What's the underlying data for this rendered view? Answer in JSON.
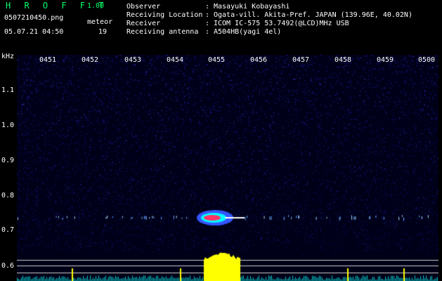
{
  "header": {
    "app_title": "H R O F F T",
    "app_version": "1.00",
    "filename": "0507210450.png",
    "datetime": "05.07.21 04:50",
    "meteor_label": "meteor",
    "meteor_count": "19"
  },
  "info": [
    {
      "key": "Observer",
      "value": "Masayuki Kobayashi"
    },
    {
      "key": "Receiving Location",
      "value": "Ogata-vill. Akita-Pref. JAPAN (139.96E, 40.02N)"
    },
    {
      "key": "Receiver",
      "value": "ICOM IC-575 53.7492(@LCD)MHz USB"
    },
    {
      "key": "Receiving antenna",
      "value": "A504HB(yagi 4el)"
    }
  ],
  "info_separator": ":",
  "spectrogram": {
    "freq_unit": "kHz",
    "time_ticks": [
      "0451",
      "0452",
      "0453",
      "0454",
      "0455",
      "0456",
      "0457",
      "0458",
      "0459",
      "0500"
    ],
    "freq_ticks": [
      "1.1",
      "1.0",
      "0.9",
      "0.8",
      "0.7",
      "0.6"
    ],
    "colors": {
      "background": "#000018",
      "noise": "#2222aa",
      "echo_core": "#ff3366",
      "echo_mid": "#00ffff",
      "echo_edge": "#3355ff",
      "bar_fill": "#ffff00",
      "bar_low": "#00cccc",
      "ref_line": "#cccccc"
    }
  }
}
